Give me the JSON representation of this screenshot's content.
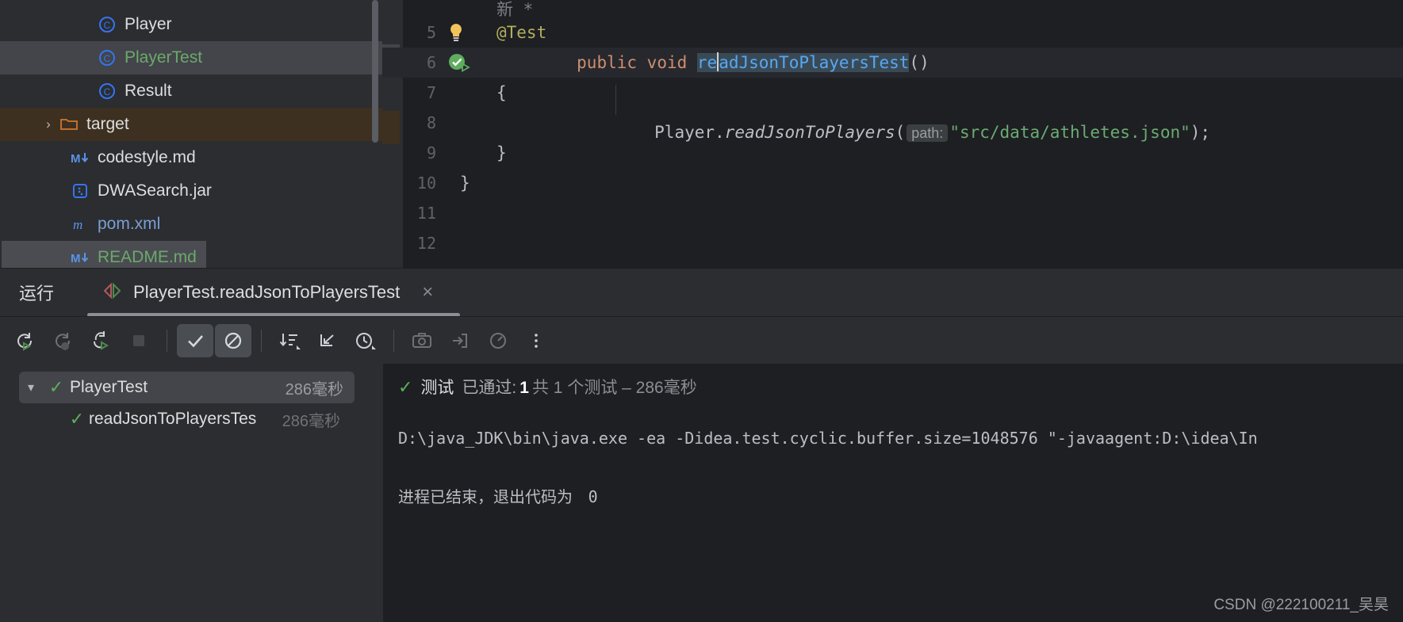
{
  "project_tree": {
    "items": [
      {
        "icon": "java-class-icon",
        "label": "Player",
        "state": "normal",
        "color": "normal"
      },
      {
        "icon": "java-class-icon",
        "label": "PlayerTest",
        "state": "selected",
        "color": "green"
      },
      {
        "icon": "java-class-icon",
        "label": "Result",
        "state": "normal",
        "color": "normal"
      },
      {
        "icon": "folder-icon",
        "label": "target",
        "state": "target",
        "color": "normal",
        "arrow": "›"
      },
      {
        "icon": "markdown-icon",
        "label": "codestyle.md",
        "state": "normal",
        "color": "normal"
      },
      {
        "icon": "jar-icon",
        "label": "DWASearch.jar",
        "state": "normal",
        "color": "normal"
      },
      {
        "icon": "maven-icon",
        "label": "pom.xml",
        "state": "normal",
        "color": "blue"
      },
      {
        "icon": "markdown-icon",
        "label": "README.md",
        "state": "hover",
        "color": "green"
      }
    ]
  },
  "editor": {
    "lines": [
      {
        "num": "",
        "text_parts": [
          {
            "t": "新 *",
            "c": "comment"
          }
        ]
      },
      {
        "num": "5",
        "gutter_icon": "lightbulb-icon",
        "text_parts": [
          {
            "t": "@Test",
            "c": "anno"
          }
        ]
      },
      {
        "num": "6",
        "gutter_icon": "run-test-gutter-icon",
        "current": true
      },
      {
        "num": "7",
        "text_parts": [
          {
            "t": "{",
            "c": "plain"
          }
        ]
      },
      {
        "num": "8",
        "text_parts": []
      },
      {
        "num": "9",
        "text_parts": [
          {
            "t": "}",
            "c": "plain"
          }
        ]
      },
      {
        "num": "10",
        "text_parts": [
          {
            "t": "}",
            "c": "plain"
          }
        ]
      },
      {
        "num": "11",
        "text_parts": []
      },
      {
        "num": "12",
        "text_parts": []
      }
    ],
    "line6": {
      "kw_public": "public",
      "kw_void": "void",
      "method_pre": "re",
      "method_post": "adJsonToPlayersTest",
      "parens": "()"
    },
    "line8": {
      "receiver": "Player",
      "dot": ".",
      "method": "readJsonToPlayers",
      "open_paren": "(",
      "param_hint": "path:",
      "string": "\"src/data/athletes.json\"",
      "close": ");"
    }
  },
  "run_window": {
    "title": "运行",
    "tab_label": "PlayerTest.readJsonToPlayersTest",
    "tab_close": "×",
    "toolbar": [
      {
        "name": "rerun-button",
        "icon": "rerun-icon",
        "state": "enabled"
      },
      {
        "name": "rerun-failed-tests-button",
        "icon": "rerun-failed-icon",
        "state": "disabled"
      },
      {
        "name": "toggle-auto-test-button",
        "icon": "auto-test-icon",
        "state": "enabled"
      },
      {
        "name": "stop-button",
        "icon": "stop-icon",
        "state": "disabled"
      },
      {
        "name": "show-passed-button",
        "icon": "checkmark-icon",
        "state": "active"
      },
      {
        "name": "show-ignored-button",
        "icon": "ignored-icon",
        "state": "active"
      },
      {
        "name": "sort-by-duration-button",
        "icon": "sort-icon",
        "state": "enabled"
      },
      {
        "name": "expand-collapse-button",
        "icon": "collapse-icon",
        "state": "enabled"
      },
      {
        "name": "history-button",
        "icon": "clock-icon",
        "state": "enabled"
      },
      {
        "name": "screenshot-button",
        "icon": "camera-icon",
        "state": "disabled"
      },
      {
        "name": "export-button",
        "icon": "export-icon",
        "state": "disabled"
      },
      {
        "name": "profile-button",
        "icon": "gauge-icon",
        "state": "disabled"
      },
      {
        "name": "more-options-button",
        "icon": "more-vertical-icon",
        "state": "enabled"
      }
    ],
    "tests": [
      {
        "name": "PlayerTest",
        "time": "286毫秒",
        "selected": true,
        "expanded": true,
        "status": "passed",
        "dim_time": false
      },
      {
        "name": "readJsonToPlayersTes",
        "time": "286毫秒",
        "selected": false,
        "expanded": false,
        "status": "passed",
        "dim_time": true
      }
    ],
    "console": {
      "status_label": "测试",
      "status_passed": "已通过:",
      "status_count": "1",
      "status_rest": "共 1 个测试 – 286毫秒",
      "command": "D:\\java_JDK\\bin\\java.exe -ea -Didea.test.cyclic.buffer.size=1048576 \"-javaagent:D:\\idea\\In",
      "exit_text": "进程已结束，退出代码为",
      "exit_code": "0"
    }
  },
  "watermark": "CSDN @222100211_吴昊",
  "colors": {
    "panel_bg": "#2b2d30",
    "editor_bg": "#1e1f22",
    "selection": "#43454a",
    "target_row": "#3d3020",
    "green": "#6ca86c",
    "blue": "#56a8f5",
    "string_green": "#6aab73",
    "keyword_orange": "#cf8e6d",
    "annotation_yellow": "#b3ae60"
  }
}
